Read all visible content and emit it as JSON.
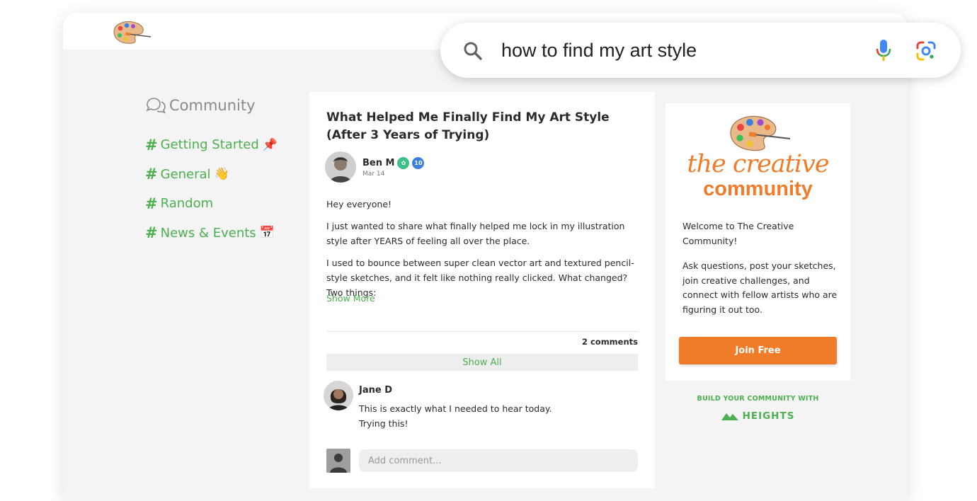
{
  "search": {
    "query": "how to find my art style"
  },
  "nav": {
    "title": "Community",
    "channels": [
      {
        "label": "Getting Started",
        "emoji": "📌"
      },
      {
        "label": "General",
        "emoji": "👋"
      },
      {
        "label": "Random",
        "emoji": ""
      },
      {
        "label": "News & Events",
        "emoji": "📅"
      }
    ]
  },
  "post": {
    "title": "What Helped Me Finally Find My Art Style (After 3 Years of Trying)",
    "author": "Ben M",
    "level_badge": "10",
    "date": "Mar 14",
    "paragraphs": [
      "Hey everyone!",
      "I just wanted to share what finally helped me lock in my illustration style after YEARS of feeling all over the place.",
      "I used to bounce between super clean vector art and textured pencil-style sketches, and it felt like nothing really clicked. What changed? Two things:"
    ],
    "show_more": "Show More",
    "comment_count": "2 comments",
    "show_all": "Show All",
    "comment": {
      "author": "Jane D",
      "lines": [
        "This is exactly what I needed to hear today.",
        "Trying this!"
      ]
    },
    "add_comment_placeholder": "Add comment..."
  },
  "sidebar": {
    "brand_line1": "the creative",
    "brand_line2": "community",
    "welcome": "Welcome to The Creative Community!",
    "description": "Ask questions, post your sketches, join creative challenges, and connect with fellow artists who are figuring it out too.",
    "join_label": "Join Free"
  },
  "footer": {
    "build_text": "BUILD YOUR COMMUNITY WITH",
    "brand": "HEIGHTS"
  },
  "colors": {
    "accent_green": "#4caf50",
    "brand_orange": "#f07c2a",
    "background": "#f4f4f4"
  }
}
